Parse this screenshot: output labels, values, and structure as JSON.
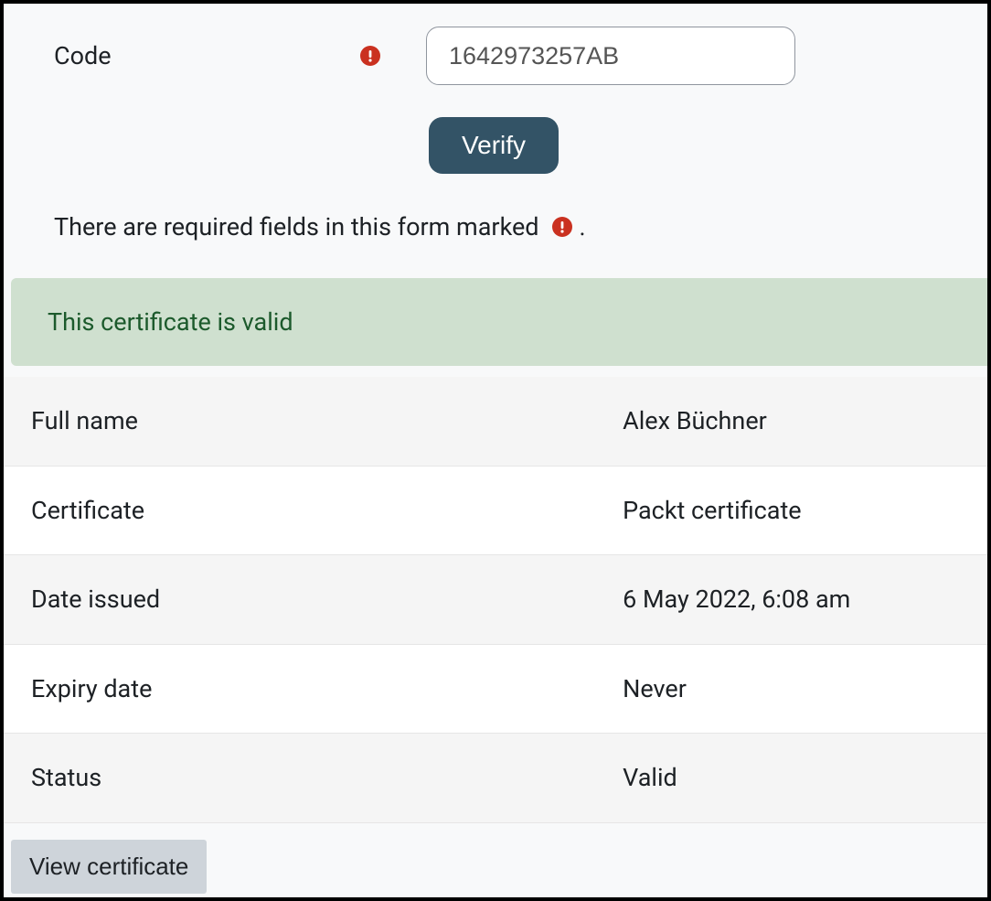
{
  "form": {
    "code_label": "Code",
    "code_value": "1642973257AB",
    "verify_label": "Verify",
    "required_note_text": "There are required fields in this form marked",
    "required_note_suffix": "."
  },
  "alert": {
    "message": "This certificate is valid"
  },
  "details": {
    "rows": [
      {
        "label": "Full name",
        "value": "Alex Büchner"
      },
      {
        "label": "Certificate",
        "value": "Packt certificate"
      },
      {
        "label": "Date issued",
        "value": "6 May 2022, 6:08 am"
      },
      {
        "label": "Expiry date",
        "value": "Never"
      },
      {
        "label": "Status",
        "value": "Valid"
      }
    ]
  },
  "actions": {
    "view_certificate_label": "View certificate"
  }
}
